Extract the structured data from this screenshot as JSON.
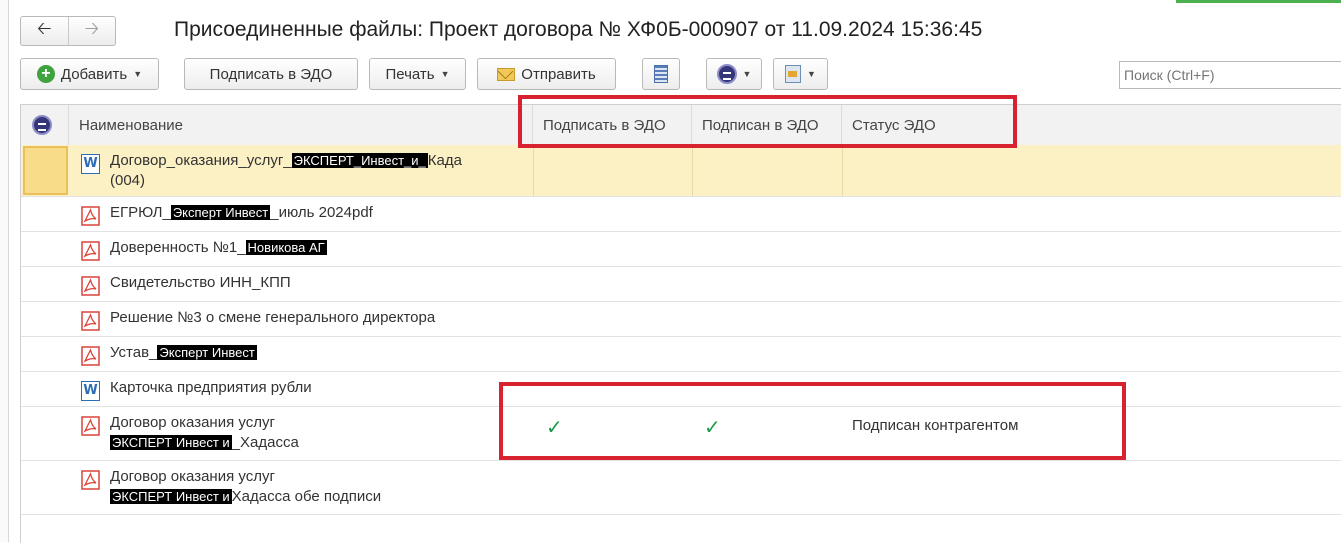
{
  "window": {
    "title": "Присоединенные файлы: Проект договора № ХФ0Б-000907 от 11.09.2024 15:36:45"
  },
  "toolbar": {
    "add_label": "Добавить",
    "sign_edo_label": "Подписать в ЭДО",
    "print_label": "Печать",
    "send_label": "Отправить"
  },
  "search": {
    "placeholder": "Поиск (Ctrl+F)"
  },
  "table": {
    "columns": [
      "Наименование",
      "Подписать в ЭДО",
      "Подписан в ЭДО",
      "Статус ЭДО"
    ],
    "rows": [
      {
        "type": "word",
        "text1": "Договор_оказания_услуг_",
        "redacted": "ЭКСПЕРТ_Инвест_и_",
        "text2": "Када",
        "line2": "(004)",
        "signed_check": "",
        "signed_edo_check": "",
        "status": ""
      },
      {
        "type": "pdf",
        "text1": "ЕГРЮЛ_",
        "redacted": "Эксперт Инвест",
        "text2": "_июль 2024pdf",
        "line2": "",
        "signed_check": "",
        "signed_edo_check": "",
        "status": ""
      },
      {
        "type": "pdf",
        "text1": "Доверенность №1_",
        "redacted": "Новикова АГ",
        "text2": "",
        "line2": "",
        "signed_check": "",
        "signed_edo_check": "",
        "status": ""
      },
      {
        "type": "pdf",
        "text1": "Свидетельство ИНН_КПП",
        "redacted": "",
        "text2": "",
        "line2": "",
        "signed_check": "",
        "signed_edo_check": "",
        "status": ""
      },
      {
        "type": "pdf",
        "text1": "Решение №3 о смене генерального директора",
        "redacted": "",
        "text2": "",
        "line2": "",
        "signed_check": "",
        "signed_edo_check": "",
        "status": ""
      },
      {
        "type": "pdf",
        "text1": "Устав_",
        "redacted": "Эксперт Инвест",
        "text2": "",
        "line2": "",
        "signed_check": "",
        "signed_edo_check": "",
        "status": ""
      },
      {
        "type": "word",
        "text1": "Карточка предприятия рубли",
        "redacted": "",
        "text2": "",
        "line2": "",
        "signed_check": "",
        "signed_edo_check": "",
        "status": ""
      },
      {
        "type": "pdf",
        "text1": "Договор оказания услуг",
        "redacted": "ЭКСПЕРТ Инвест и",
        "text2": "_Хадасса",
        "line2": "",
        "signed_check": "✓",
        "signed_edo_check": "✓",
        "status": "Подписан контрагентом"
      },
      {
        "type": "pdf",
        "text1": "Договор оказания услуг",
        "redacted": "ЭКСПЕРТ Инвест и",
        "text2": "Хадасса обе подписи",
        "line2": "",
        "signed_check": "",
        "signed_edo_check": "",
        "status": ""
      }
    ]
  },
  "colors": {
    "highlight_box": "#d6232f",
    "check": "#1a9a4e",
    "selected_row": "#fcf0c5"
  }
}
